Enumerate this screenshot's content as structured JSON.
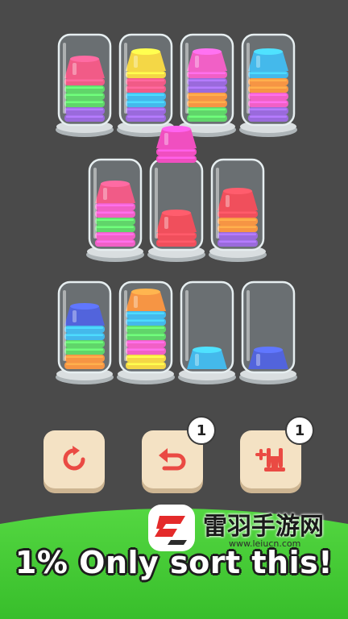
{
  "game": {
    "tubes": [
      {
        "cups": [
          "#8f5ad9",
          "#8f5ad9",
          "#4fd15a",
          "#4fd15a",
          "#4fd15a",
          "#f0497a",
          "#f0497a"
        ]
      },
      {
        "cups": [
          "#8f5ad9",
          "#8f5ad9",
          "#2fb2e9",
          "#2fb2e9",
          "#f0497a",
          "#f0497a",
          "#f3d331",
          "#f3d331"
        ]
      },
      {
        "cups": [
          "#4fd15a",
          "#4fd15a",
          "#f58a2f",
          "#f58a2f",
          "#8f5ad9",
          "#8f5ad9",
          "#f04fc0",
          "#f04fc0"
        ]
      },
      {
        "cups": [
          "#8f5ad9",
          "#8f5ad9",
          "#f04fc0",
          "#f04fc0",
          "#f58a2f",
          "#f58a2f",
          "#2fb2e9",
          "#2fb2e9"
        ]
      },
      {
        "cups": [
          "#f04fc0",
          "#f04fc0",
          "#4fd15a",
          "#4fd15a",
          "#f04fc0",
          "#f04fc0",
          "#f0497a"
        ]
      },
      {
        "cups": [
          "#ef3c4a",
          "#ef3c4a",
          "#ef3c4a"
        ]
      },
      {
        "cups": [
          "#8f5ad9",
          "#8f5ad9",
          "#f58a2f",
          "#f58a2f",
          "#ef3c4a",
          "#ef3c4a"
        ]
      },
      {
        "cups": [
          "#f58a2f",
          "#f58a2f",
          "#4fd15a",
          "#4fd15a",
          "#2fb2e9",
          "#2fb2e9",
          "#3f53d9"
        ]
      },
      {
        "cups": [
          "#f3d331",
          "#f3d331",
          "#f04fc0",
          "#f04fc0",
          "#4fd15a",
          "#4fd15a",
          "#2fb2e9",
          "#2fb2e9",
          "#f58a2f"
        ]
      },
      {
        "cups": [
          "#2fb2e9"
        ]
      },
      {
        "cups": [
          "#3f53d9"
        ]
      }
    ],
    "lifted_cups": [
      "#f04fc0",
      "#f04fc0",
      "#f04fc0"
    ]
  },
  "buttons": {
    "restart": {
      "icon": "restart-icon"
    },
    "undo": {
      "icon": "undo-icon",
      "badge": "1"
    },
    "add_tube": {
      "icon": "add-tube-icon",
      "badge": "1"
    }
  },
  "footer": {
    "promo_text": "1% Only sort this!"
  },
  "watermark": {
    "name": "雷羽手游网",
    "url": "www.leiucn.com"
  }
}
